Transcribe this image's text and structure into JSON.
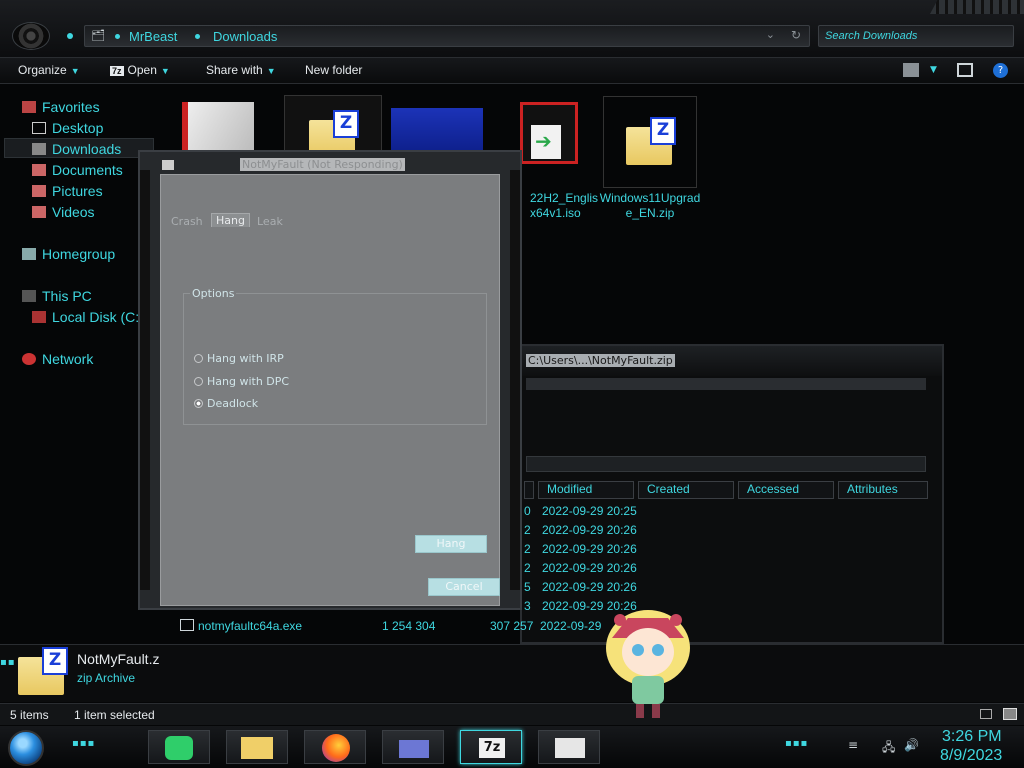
{
  "address": {
    "crumbs": [
      "MrBeast",
      "Downloads"
    ],
    "search_placeholder": "Search Downloads"
  },
  "toolbar": {
    "organize": "Organize",
    "open": "Open",
    "share_with": "Share with",
    "new_folder": "New folder"
  },
  "sidebar": {
    "favorites": "Favorites",
    "desktop": "Desktop",
    "downloads": "Downloads",
    "documents": "Documents",
    "pictures": "Pictures",
    "videos": "Videos",
    "homegroup": "Homegroup",
    "this_pc": "This PC",
    "local_disk": "Local Disk (C:)",
    "network": "Network"
  },
  "files": {
    "iso_name_line1": "22H2_Englis",
    "iso_name_line2": "x64v1.iso",
    "win11_line1": "Windows11Upgrad",
    "win11_line2": "e_EN.zip"
  },
  "zwin": {
    "title": "C:\\Users\\...\\NotMyFault.zip",
    "columns": [
      "Modified",
      "Created",
      "Accessed",
      "Attributes"
    ],
    "rows": [
      {
        "frag": "0",
        "modified": "2022-09-29 20:25"
      },
      {
        "frag": "2",
        "modified": "2022-09-29 20:26"
      },
      {
        "frag": "2",
        "modified": "2022-09-29 20:26"
      },
      {
        "frag": "2",
        "modified": "2022-09-29 20:26"
      },
      {
        "frag": "5",
        "modified": "2022-09-29 20:26"
      },
      {
        "frag": "3",
        "modified": "2022-09-29 20:26"
      }
    ],
    "last_row": {
      "name": "notmyfaultc64a.exe",
      "size": "1 254 304",
      "packed": "307 257",
      "modified": "2022-09-29"
    }
  },
  "dialog": {
    "title": "NotMyFault (Not Responding)",
    "tabs": [
      "Crash",
      "Hang",
      "Leak"
    ],
    "options_label": "Options",
    "radio_irp": "Hang with IRP",
    "radio_dpc": "Hang with DPC",
    "radio_deadlock": "Deadlock",
    "hang_button": "Hang",
    "cancel_button": "Cancel"
  },
  "details": {
    "name": "NotMyFault.z",
    "type": "zip Archive"
  },
  "status": {
    "items": "5 items",
    "selected": "1 item selected"
  },
  "clock": {
    "time": "3:26 PM",
    "date": "8/9/2023"
  },
  "colors": {
    "accent": "#3fd7e0",
    "background": "#050607"
  }
}
